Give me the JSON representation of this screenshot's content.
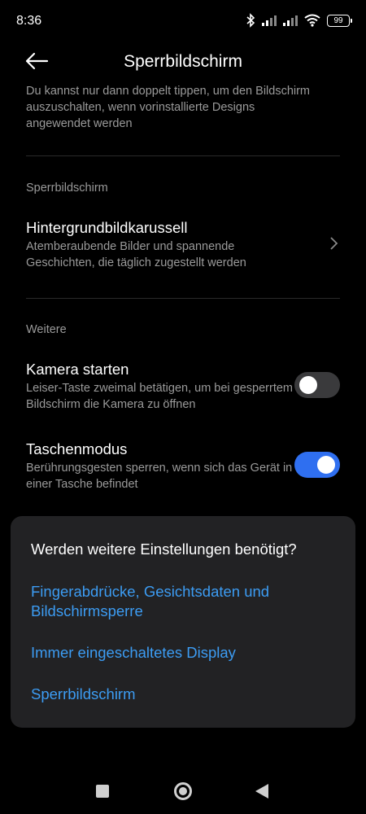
{
  "status": {
    "time": "8:36",
    "battery": "99"
  },
  "header": {
    "title": "Sperrbildschirm"
  },
  "clipped_text": "Du kannst nur dann doppelt tippen, um den Bildschirm auszuschalten, wenn vorinstallierte Designs angewendet werden",
  "sections": {
    "lockscreen": "Sperrbildschirm",
    "more": "Weitere"
  },
  "items": {
    "carousel": {
      "title": "Hintergrundbildkarussell",
      "desc": "Atemberaubende Bilder und spannende Geschichten, die täglich zugestellt werden"
    },
    "camera": {
      "title": "Kamera starten",
      "desc": "Leiser-Taste zweimal betätigen, um bei gesperrtem Bildschirm die Kamera zu öffnen",
      "enabled": false
    },
    "pocket": {
      "title": "Taschenmodus",
      "desc": "Berührungsgesten sperren, wenn sich das Gerät in einer Tasche befindet",
      "enabled": true
    }
  },
  "sheet": {
    "title": "Werden weitere Einstellungen benötigt?",
    "links": [
      "Fingerabdrücke, Gesichtsdaten und Bildschirmsperre",
      "Immer eingeschaltetes Display",
      "Sperrbildschirm"
    ]
  },
  "colors": {
    "accent": "#2f6ff0",
    "link": "#3c9cf3",
    "sheet_bg": "#222224"
  }
}
